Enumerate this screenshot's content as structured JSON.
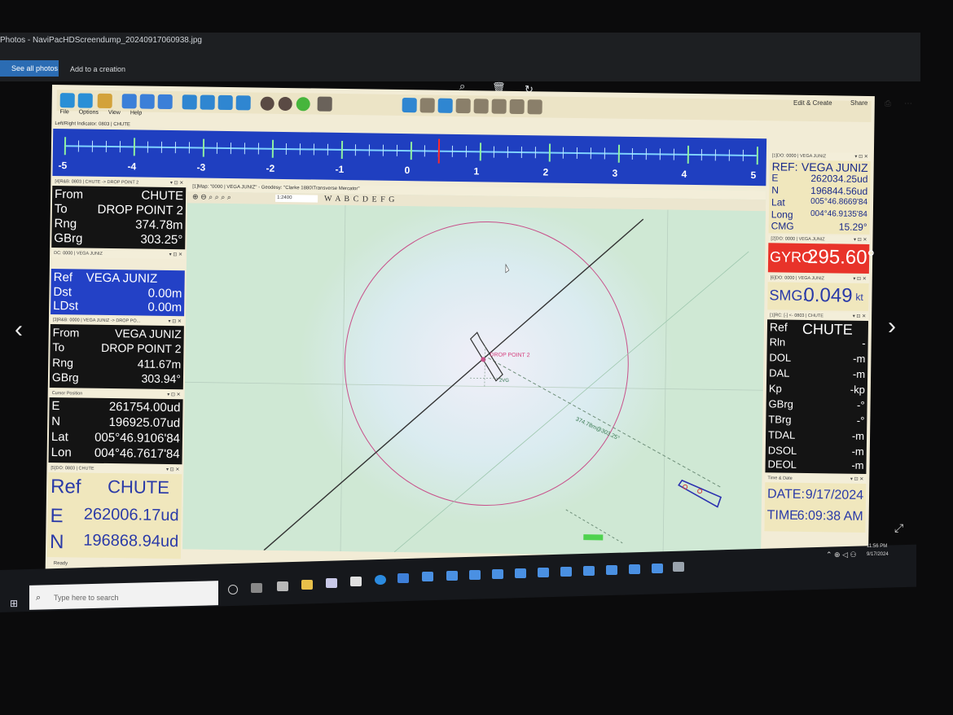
{
  "photos": {
    "window_title": "Photos - NaviPacHDScreendump_20240917060938.jpg",
    "see_all": "See all photos",
    "add_creation": "Add to a creation",
    "edit_create": "Edit & Create",
    "share": "Share"
  },
  "app": {
    "menu": [
      "File",
      "Options",
      "View",
      "Help"
    ],
    "lr_title": "Left/Right Indicator: 0803 | CHUTE",
    "lr_scale": [
      "-5",
      "-4",
      "-3",
      "-2",
      "-1",
      "0",
      "1",
      "2",
      "3",
      "4",
      "5"
    ],
    "status": "Ready"
  },
  "left_panels": {
    "rb1": {
      "title": "[4]R&B: 0803 | CHUTE -> DROP POINT 2",
      "rows": [
        {
          "k": "From",
          "v": "CHUTE"
        },
        {
          "k": "To",
          "v": "DROP POINT 2"
        },
        {
          "k": "Rng",
          "v": "374.78m"
        },
        {
          "k": "GBrg",
          "v": "303.25°"
        }
      ]
    },
    "dc": {
      "title": "DC: 0000 | VEGA JUNIZ",
      "rows": [
        {
          "k": "Ref",
          "v": "VEGA JUNIZ"
        },
        {
          "k": "Dst",
          "v": "0.00m"
        },
        {
          "k": "LDst",
          "v": "0.00m"
        }
      ]
    },
    "rb2": {
      "title": "[3]R&B: 0000 | VEGA JUNIZ -> DROP PO...",
      "rows": [
        {
          "k": "From",
          "v": "VEGA JUNIZ"
        },
        {
          "k": "To",
          "v": "DROP POINT 2"
        },
        {
          "k": "Rng",
          "v": "411.67m"
        },
        {
          "k": "GBrg",
          "v": "303.94°"
        }
      ]
    },
    "cursor": {
      "title": "Cursor Position",
      "rows": [
        {
          "k": "E",
          "v": "261754.00ud"
        },
        {
          "k": "N",
          "v": "196925.07ud"
        },
        {
          "k": "Lat",
          "v": "005°46.9106'84"
        },
        {
          "k": "Lon",
          "v": "004°46.7617'84"
        }
      ]
    },
    "do_chute": {
      "title": "[5]DO: 0803 | CHUTE",
      "rows": [
        {
          "k": "Ref",
          "v": "CHUTE"
        },
        {
          "k": "E",
          "v": "262006.17ud"
        },
        {
          "k": "N",
          "v": "196868.94ud"
        }
      ]
    }
  },
  "right_panels": {
    "do_vega": {
      "title": "[1]DO: 0000 | VEGA JUNIZ",
      "rows": [
        {
          "k": "REF:",
          "v": "VEGA JUNIZ"
        },
        {
          "k": "E",
          "v": "262034.25ud"
        },
        {
          "k": "N",
          "v": "196844.56ud"
        },
        {
          "k": "Lat",
          "v": "005°46.8669'84"
        },
        {
          "k": "Long",
          "v": "004°46.9135'84"
        },
        {
          "k": "CMG",
          "v": "15.29°"
        }
      ]
    },
    "gyro": {
      "title": "[2]DO: 0000 | VEGA JUNIZ",
      "label": "GYRO:",
      "value": "295.60°"
    },
    "smg": {
      "title": "[6]DO: 0000 | VEGA JUNIZ",
      "label": "SMG:",
      "value": "0.049",
      "unit": "kt"
    },
    "rc": {
      "title": "[1]RC: [-] <- 0803 | CHUTE",
      "rows": [
        {
          "k": "Ref",
          "v": "CHUTE"
        },
        {
          "k": "Rln",
          "v": "-"
        },
        {
          "k": "DOL",
          "v": "-m"
        },
        {
          "k": "DAL",
          "v": "-m"
        },
        {
          "k": "Kp",
          "v": "-kp"
        },
        {
          "k": "GBrg",
          "v": "-°"
        },
        {
          "k": "TBrg",
          "v": "-°"
        },
        {
          "k": "TDAL",
          "v": "-m"
        },
        {
          "k": "DSOL",
          "v": "-m"
        },
        {
          "k": "DEOL",
          "v": "-m"
        }
      ]
    },
    "time": {
      "title": "Time & Date",
      "rows": [
        {
          "k": "DATE:",
          "v": "9/17/2024"
        },
        {
          "k": "TIME",
          "v": "6:09:38 AM"
        }
      ]
    }
  },
  "map": {
    "title": "[1]Map: \"0000 | VEGA JUNIZ\" - Geodesy: \"Clarke 1880\\Transverse Mercator\"",
    "scale": "1:2400",
    "layers": "W A B C D E F G",
    "label_drop": "DROP POINT 2",
    "label_vessel": "2VG",
    "label_line": "374.78m@303.25°"
  },
  "taskbar": {
    "search_placeholder": "Type here to search",
    "time": "11:56 PM",
    "date": "9/17/2024"
  },
  "colors": {
    "ruler_blue": "#1f3fc0",
    "gyro_red": "#e8332a",
    "panel_blue": "#2341c6",
    "panel_dark": "#141414"
  }
}
